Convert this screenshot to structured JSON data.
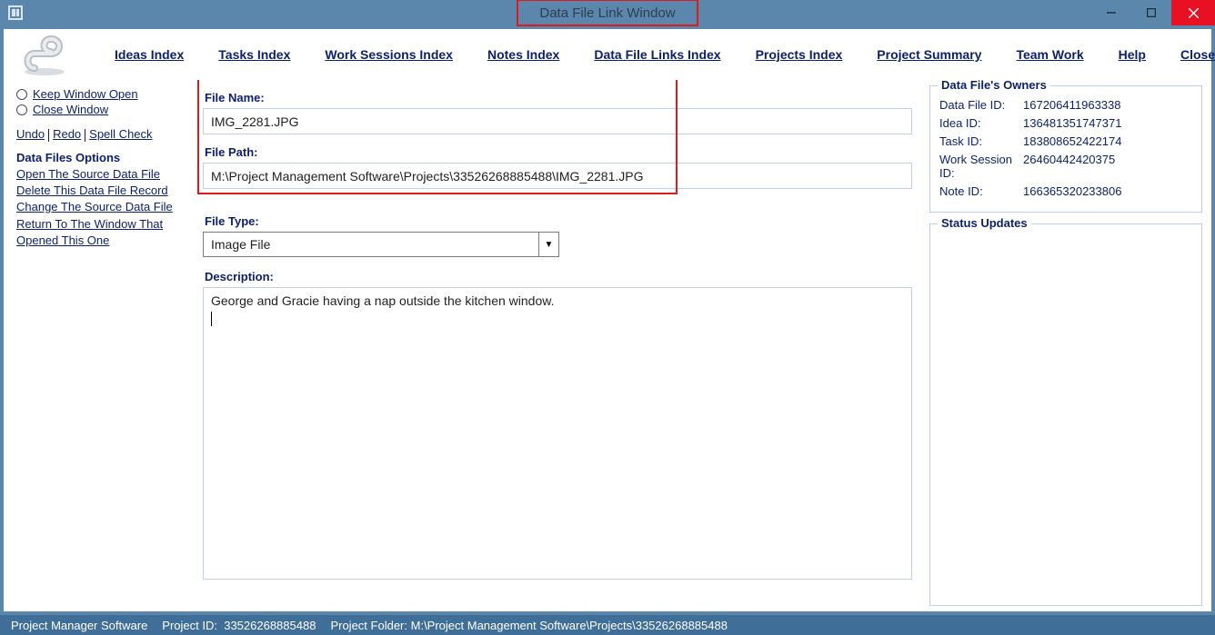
{
  "window": {
    "title": "Data File Link Window"
  },
  "menu": {
    "ideas": "Ideas Index",
    "tasks": "Tasks Index",
    "work": "Work Sessions Index",
    "notes": "Notes Index",
    "links": "Data File Links Index",
    "projects": "Projects Index",
    "summary": "Project Summary",
    "team": "Team Work",
    "help": "Help",
    "close": "Close Program"
  },
  "sidebar": {
    "keep_open": "Keep Window Open",
    "close_window": "Close Window",
    "undo": "Undo",
    "redo": "Redo",
    "spell": "Spell Check",
    "options_heading": "Data Files Options",
    "open_source": "Open The Source Data File",
    "delete_record": "Delete This Data File Record",
    "change_source": "Change The Source Data File",
    "return": "Return To The Window That Opened This One"
  },
  "form": {
    "file_name_label": "File Name:",
    "file_name": "IMG_2281.JPG",
    "file_path_label": "File Path:",
    "file_path": "M:\\Project Management Software\\Projects\\33526268885488\\IMG_2281.JPG",
    "file_type_label": "File Type:",
    "file_type": "Image File",
    "description_label": "Description:",
    "description": "George and Gracie having a nap outside the kitchen window."
  },
  "owners": {
    "legend": "Data File's Owners",
    "rows": [
      {
        "label": "Data File ID:",
        "value": "167206411963338"
      },
      {
        "label": "Idea ID:",
        "value": "136481351747371"
      },
      {
        "label": "Task ID:",
        "value": "183808652422174"
      },
      {
        "label": "Work Session ID:",
        "value": "26460442420375"
      },
      {
        "label": "Note ID:",
        "value": "166365320233806"
      }
    ]
  },
  "status_updates": {
    "legend": "Status Updates"
  },
  "statusbar": {
    "app": "Project Manager Software",
    "project_id_label": "Project ID:",
    "project_id": "33526268885488",
    "folder_label": "Project Folder:",
    "folder": "M:\\Project Management Software\\Projects\\33526268885488"
  }
}
